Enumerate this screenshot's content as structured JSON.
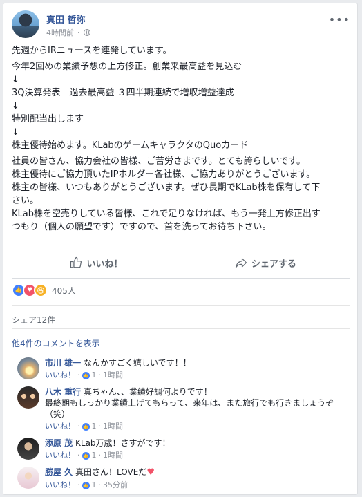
{
  "post": {
    "author": "真田 哲弥",
    "time": "4時間前",
    "more": "•••",
    "lines": [
      "先週からIRニュースを連発しています。",
      "今年2回めの業績予想の上方修正。創業来最高益を見込む",
      "↓",
      "3Q決算発表　過去最高益 ３四半期連続で増収増益達成",
      "↓",
      "特別配当出します",
      "↓",
      "株主優待始めます。KLabのゲームキャラクタのQuoカード"
    ],
    "paragraph": [
      "社員の皆さん、協力会社の皆様、ご苦労さまです。とても誇らしいです。",
      "株主優待にご協力頂いたIPホルダー各社様、ご協力ありがとうございます。",
      "株主の皆様、いつもありがとうございます。ぜひ長期でKLab株を保有して下",
      "さい。",
      "KLab株を空売りしている皆様、これで足りなければ、もう一発上方修正出す",
      "つもり（個人の願望です）ですので、首を洗ってお待ち下さい。"
    ]
  },
  "actions": {
    "like": "いいね！",
    "share": "シェアする"
  },
  "reactions": {
    "count": "405人"
  },
  "shares": "シェア12件",
  "more_comments": "他4件のコメントを表示",
  "comments": [
    {
      "name": "市川 雄一",
      "text": "なんかすごく嬉しいです！！",
      "like": "いいね！",
      "likes": "1",
      "time": "1時間"
    },
    {
      "name": "八木 重行",
      "text": "真ちゃん、、業績好調何よりです！",
      "text2": "最終期もしっかり業績上げてもらって、来年は、また旅行でも行きましょうぞ",
      "text3": "（笑）",
      "like": "いいね！",
      "likes": "1",
      "time": "1時間"
    },
    {
      "name": "添原 茂",
      "text": "KLab万歳！さすがです！",
      "like": "いいね！",
      "likes": "1",
      "time": "1時間"
    },
    {
      "name": "勝屋 久",
      "text": "真田さん！LOVEだ",
      "like": "いいね！",
      "likes": "1",
      "time": "35分前"
    }
  ],
  "colors": {
    "link": "#365899",
    "meta": "#90949c",
    "like": "#4080ff",
    "love": "#f25268",
    "haha": "#f7b125"
  }
}
